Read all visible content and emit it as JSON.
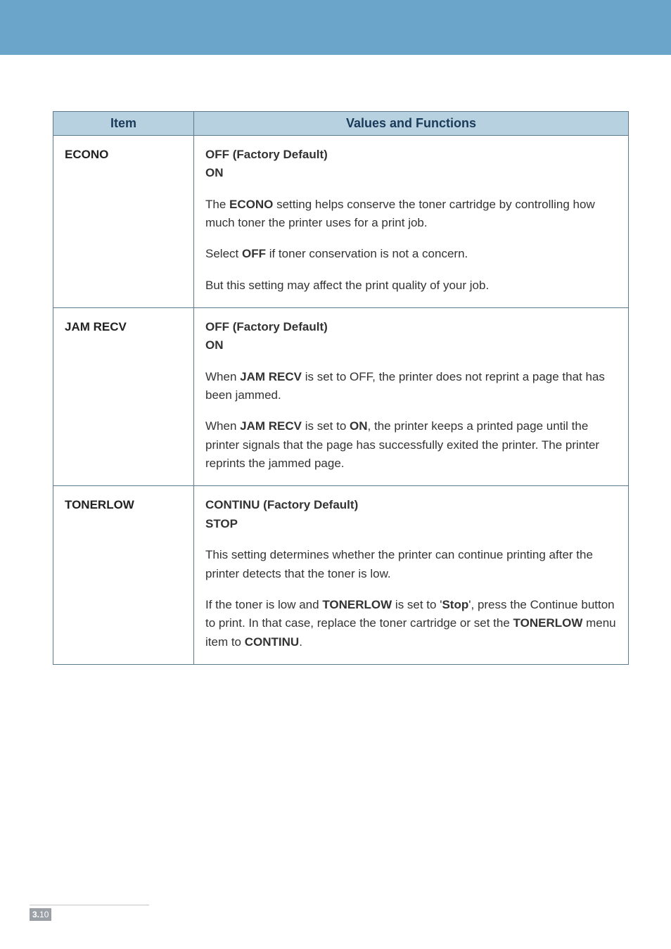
{
  "headers": {
    "item": "Item",
    "values": "Values and Functions"
  },
  "rows": [
    {
      "label": "ECONO",
      "paras": [
        "<b>OFF (Factory Default)<br>ON</b>",
        "The <b>ECONO</b> setting helps conserve the toner cartridge by controlling how much toner the printer uses for a print job.",
        "Select <b>OFF</b> if toner conservation is not a concern.",
        "But this setting may affect the print quality of your job."
      ]
    },
    {
      "label": "JAM RECV",
      "paras": [
        "<b>OFF (Factory Default)<br>ON</b>",
        "When <b>JAM RECV</b> is set to OFF, the printer does not reprint a page that has been jammed.",
        "When <b>JAM RECV</b> is set to <b>ON</b>, the printer keeps a printed page until the printer signals that the page has successfully exited the printer. The printer reprints the jammed page."
      ]
    },
    {
      "label": "TONERLOW",
      "paras": [
        "<b>CONTINU (Factory Default)<br>STOP</b>",
        "This setting determines whether the printer can continue printing after the printer detects that the toner is low.",
        "If the toner is low and <b>TONERLOW</b> is set to '<b>Stop</b>', press the Continue button to print. In that case, replace the toner cartridge or set the <b>TONERLOW</b> menu item to <b>CONTINU</b>."
      ]
    }
  ],
  "page": {
    "chapter": "3.",
    "num": "10"
  }
}
